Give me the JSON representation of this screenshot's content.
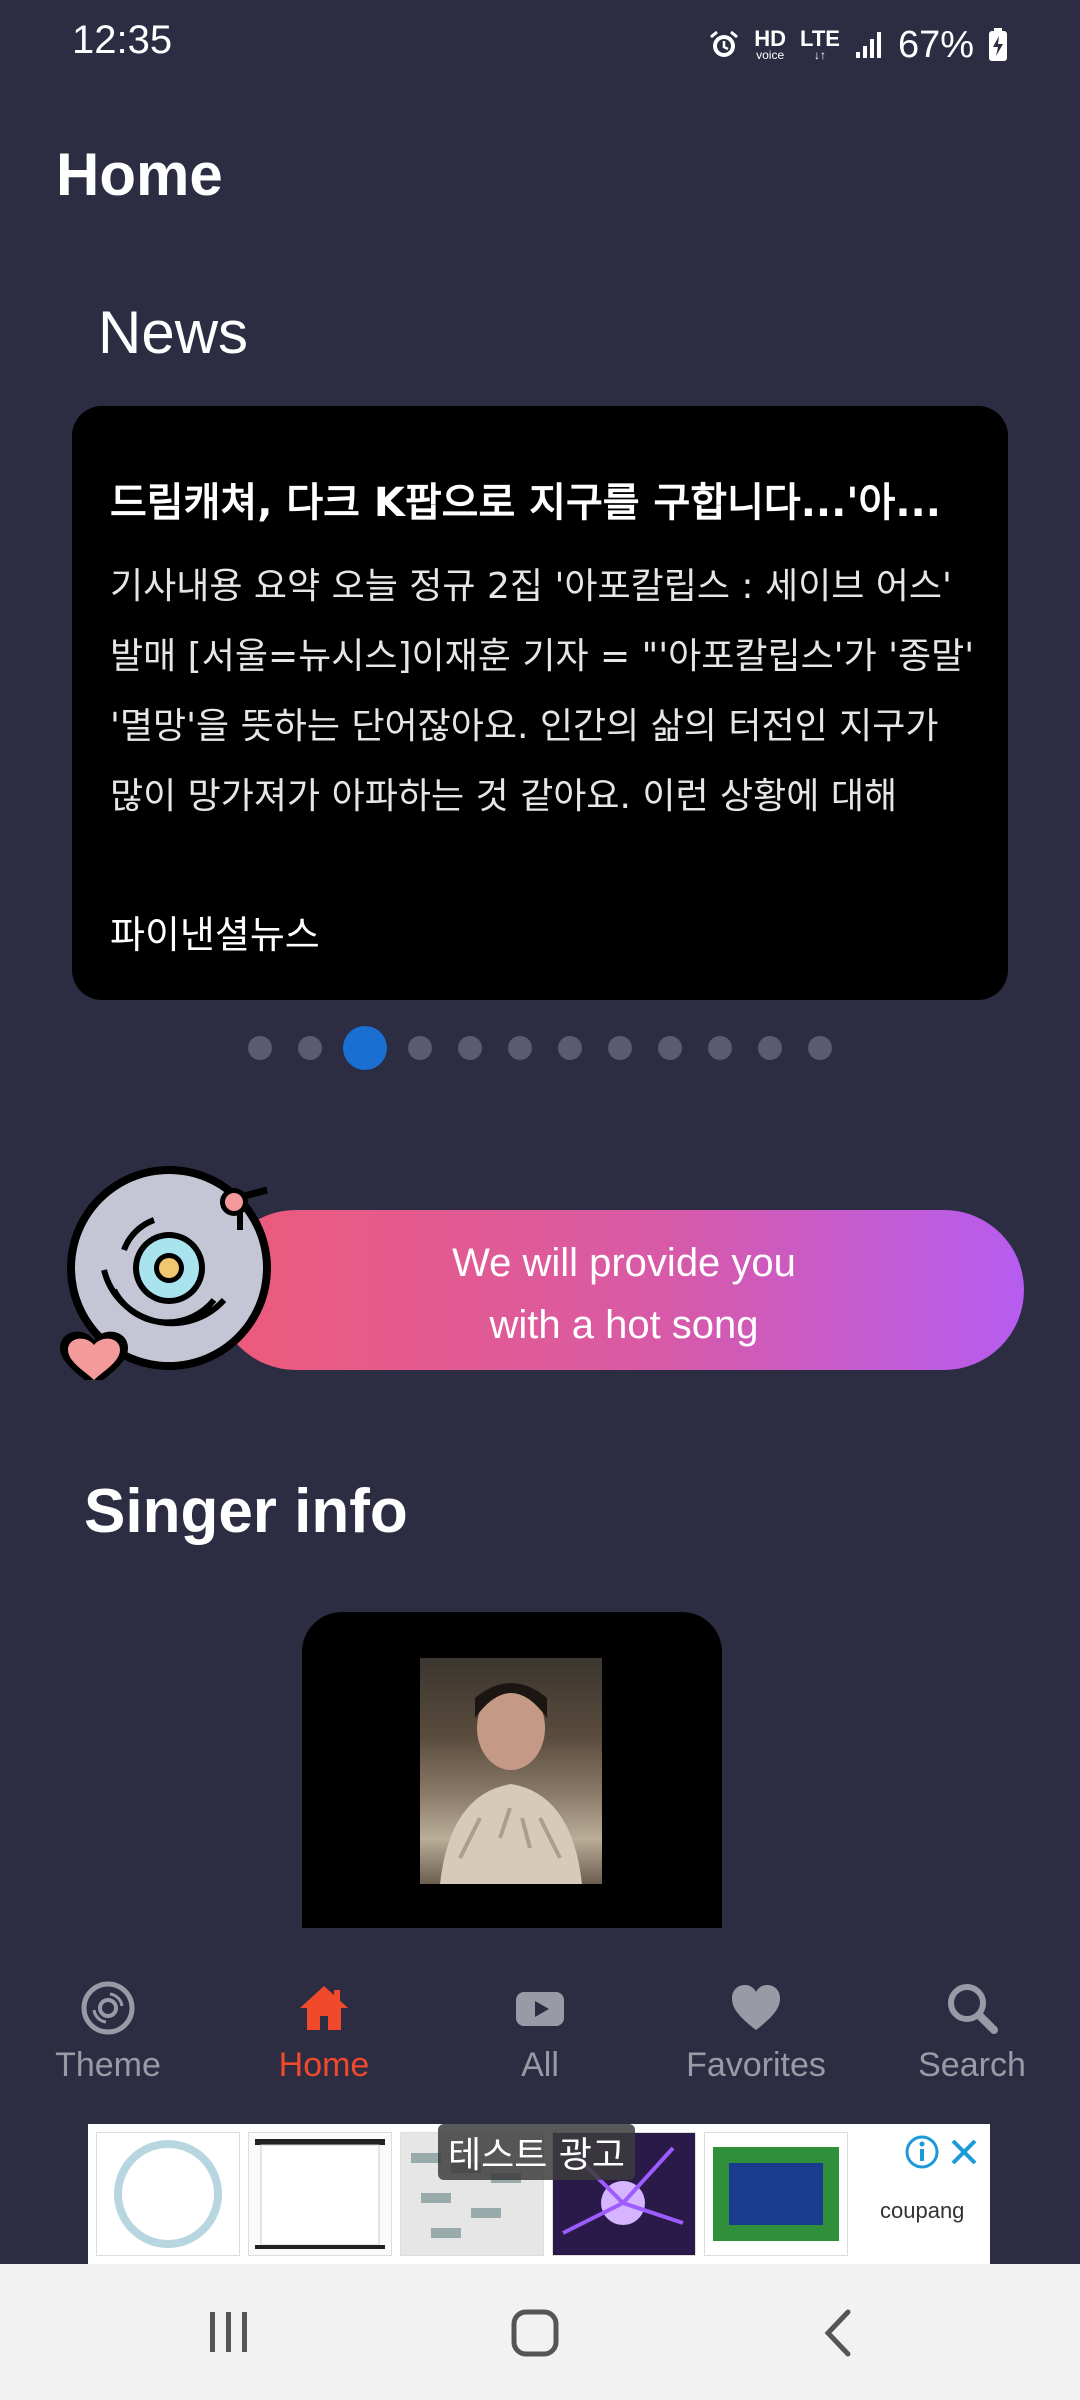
{
  "status_bar": {
    "time": "12:35",
    "hd": "HD",
    "hd_sub": "voice",
    "network": "LTE",
    "battery": "67%"
  },
  "page": {
    "title": "Home"
  },
  "news": {
    "section_title": "News",
    "card": {
      "headline": "드림캐쳐, 다크 K팝으로 지구를 구합니다...'아...",
      "body": "기사내용 요약 오늘 정규 2집 '아포칼립스 : 세이브 어스' 발매 [서울=뉴시스]이재훈 기자 = \"'아포칼립스'가 '종말' '멸망'을 뜻하는 단어잖아요. 인간의 삶의 터전인 지구가 많이 망가져가 아파하는 것 같아요. 이런 상황에 대해",
      "source": "파이낸셜뉴스"
    },
    "pager": {
      "count": 12,
      "active_index": 2
    }
  },
  "promo": {
    "line1": "We will provide you",
    "line2": "with a hot song"
  },
  "singer": {
    "section_title": "Singer info"
  },
  "nav": [
    {
      "label": "Theme",
      "icon": "disc-icon"
    },
    {
      "label": "Home",
      "icon": "home-icon",
      "active": true
    },
    {
      "label": "All",
      "icon": "play-icon"
    },
    {
      "label": "Favorites",
      "icon": "heart-icon"
    },
    {
      "label": "Search",
      "icon": "search-icon"
    }
  ],
  "ad": {
    "label": "테스트 광고",
    "brand": "coupang"
  },
  "colors": {
    "background": "#2c2d43",
    "accent": "#f0492c",
    "pager_active": "#1a6fd0"
  }
}
